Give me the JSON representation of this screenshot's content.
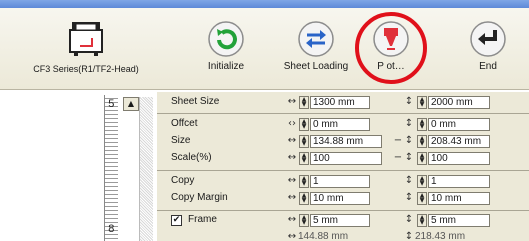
{
  "toolbar": {
    "printer_label": "CF3 Series(R1/TF2-Head)",
    "initialize_label": "Initialize",
    "sheet_loading_label": "Sheet Loading",
    "plot_label": "P ot…",
    "end_label": "End"
  },
  "ruler": {
    "top_number": "5",
    "bottom_number": "8"
  },
  "params": {
    "sheet_size": {
      "label": "Sheet Size",
      "x_value": "1300 mm",
      "y_value": "2000 mm"
    },
    "offset": {
      "label": "Offcet",
      "x_value": "0 mm",
      "y_value": "0 mm"
    },
    "size": {
      "label": "Size",
      "x_value": "134.88 mm",
      "y_value": "208.43 mm"
    },
    "scale": {
      "label": "Scale(%)",
      "x_value": "100",
      "y_value": "100"
    },
    "copy": {
      "label": "Copy",
      "x_value": "1",
      "y_value": "1"
    },
    "copy_margin": {
      "label": "Copy Margin",
      "x_value": "10 mm",
      "y_value": "10 mm"
    },
    "frame": {
      "label": "Frame",
      "checked": true,
      "x_value": "5 mm",
      "y_value": "5 mm"
    },
    "total": {
      "x_value": "144.88 mm",
      "y_value": "218.43 mm"
    }
  },
  "colors": {
    "highlight": "#e0101a",
    "plotter_red": "#e0303a",
    "button_blue": "#2a64c8",
    "button_green": "#22a23a"
  }
}
